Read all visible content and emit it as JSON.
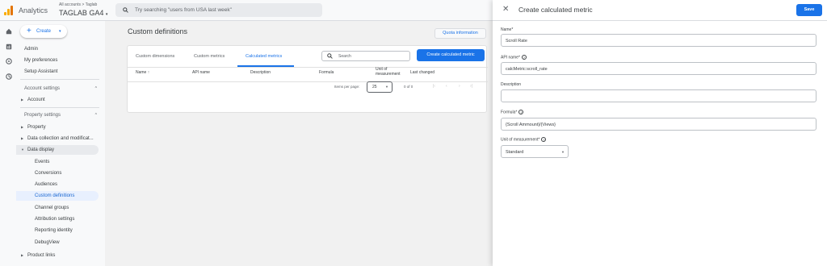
{
  "topbar": {
    "app_name": "Analytics",
    "account_crumb": "All accounts > Taglab",
    "property_name": "TAGLAB GA4",
    "search_placeholder": "Try searching \"users from USA last week\""
  },
  "sidebar": {
    "create_label": "Create",
    "admin": "Admin",
    "my_preferences": "My preferences",
    "setup_assistant": "Setup Assistant",
    "account_settings": "Account settings",
    "account": "Account",
    "property_settings": "Property settings",
    "property": "Property",
    "data_collection": "Data collection and modificat...",
    "data_display": "Data display",
    "events": "Events",
    "conversions": "Conversions",
    "audiences": "Audiences",
    "custom_definitions": "Custom definitions",
    "channel_groups": "Channel groups",
    "attribution_settings": "Attribution settings",
    "reporting_identity": "Reporting identity",
    "debugview": "DebugView",
    "product_links": "Product links"
  },
  "main": {
    "title": "Custom definitions",
    "quota_button": "Quota information",
    "tabs": [
      "Custom dimensions",
      "Custom metrics",
      "Calculated metrics"
    ],
    "search_placeholder": "Search",
    "create_button": "Create calculated metric",
    "columns": {
      "name": "Name",
      "sort_icon": "↑",
      "api_name": "API name",
      "description": "Description",
      "formula": "Formula",
      "unit_line1": "Unit of",
      "unit_line2": "measurement",
      "last_changed": "Last changed"
    },
    "pager": {
      "label": "Items per page:",
      "value": "25",
      "count": "0 of 0"
    }
  },
  "dialog": {
    "title": "Create calculated metric",
    "save": "Save",
    "name_label": "Name*",
    "name_value": "Scroll Rate",
    "api_label": "API name*",
    "api_value": "calcMetric:scroll_rate",
    "description_label": "Description",
    "description_value": "",
    "formula_label": "Formula*",
    "formula_value": "{Scroll Ammount}/{Views}",
    "unit_label": "Unit of measurement*",
    "unit_value": "Standard"
  },
  "colors": {
    "accent": "#1a73e8",
    "logo": "#f9ab00"
  }
}
